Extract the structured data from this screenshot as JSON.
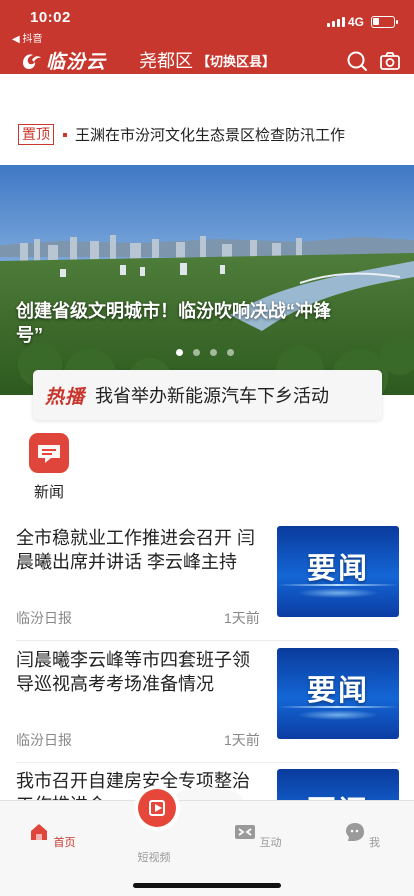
{
  "status_bar": {
    "time": "10:02",
    "back_app": "◀ 抖音",
    "network": "4G",
    "battery_level": 0.3
  },
  "header": {
    "app_name": "临汾云",
    "district": "尧都区",
    "switch_label": "【切换区县】",
    "brand_color": "#c8372d"
  },
  "pinned": {
    "tag": "置顶",
    "title": "王渊在市汾河文化生态景区检查防汛工作"
  },
  "banner": {
    "title": "创建省级文明城市！临汾吹响决战“冲锋号”",
    "slide_count": 4,
    "active_slide": 1
  },
  "hot": {
    "tag": "热播",
    "title": "我省举办新能源汽车下乡活动"
  },
  "channels": [
    {
      "label": "新闻",
      "icon": "message-icon"
    }
  ],
  "news": [
    {
      "title": "全市稳就业工作推进会召开 闫晨曦出席并讲话 李云峰主持",
      "source": "临汾日报",
      "time": "1天前",
      "thumb": "要闻"
    },
    {
      "title": "闫晨曦李云峰等市四套班子领导巡视高考考场准备情况",
      "source": "临汾日报",
      "time": "1天前",
      "thumb": "要闻"
    },
    {
      "title": "我市召开自建房安全专项整治工作推进会",
      "source": "",
      "time": "",
      "thumb": "要闻"
    }
  ],
  "tabbar": {
    "home": "首页",
    "video": "短视频",
    "interact": "互动",
    "me": "我"
  }
}
